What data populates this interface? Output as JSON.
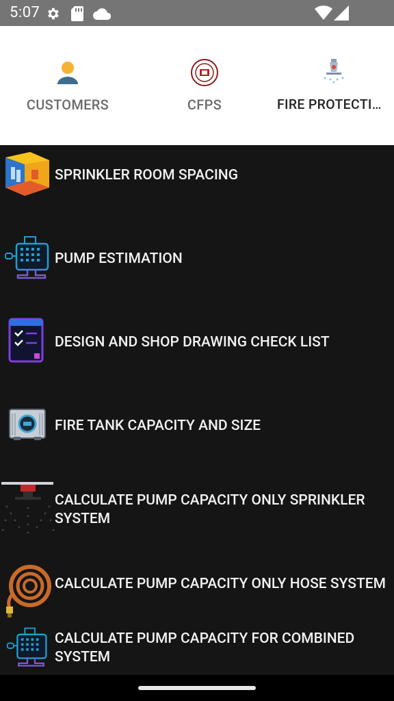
{
  "status_bar": {
    "time": "5:07",
    "icons": [
      "gear-icon",
      "sd-card-icon",
      "cloud-icon",
      "wifi-icon",
      "cell-signal-icon"
    ]
  },
  "tabs": [
    {
      "label": "CUSTOMERS",
      "icon": "person-icon",
      "active": false
    },
    {
      "label": "CFPS",
      "icon": "nfpa-seal-icon",
      "active": false
    },
    {
      "label": "FIRE PROTECTION",
      "icon": "sprinkler-icon",
      "active": true
    }
  ],
  "items": [
    {
      "label": "SPRINKLER ROOM SPACING",
      "icon": "room-3d-icon"
    },
    {
      "label": "PUMP ESTIMATION",
      "icon": "pump-icon"
    },
    {
      "label": "DESIGN AND SHOP DRAWING CHECK LIST",
      "icon": "checklist-icon"
    },
    {
      "label": "FIRE TANK CAPACITY AND SIZE",
      "icon": "tank-icon"
    },
    {
      "label": "CALCULATE PUMP CAPACITY ONLY SPRINKLER SYSTEM",
      "icon": "sprinkler-head-icon"
    },
    {
      "label": "CALCULATE PUMP CAPACITY ONLY HOSE SYSTEM",
      "icon": "hose-reel-icon"
    },
    {
      "label": "CALCULATE PUMP CAPACITY FOR COMBINED SYSTEM",
      "icon": "pump-icon"
    }
  ],
  "colors": {
    "status_bar": "#757575",
    "tab_indicator": "#1f7d71",
    "list_background": "#151515"
  }
}
